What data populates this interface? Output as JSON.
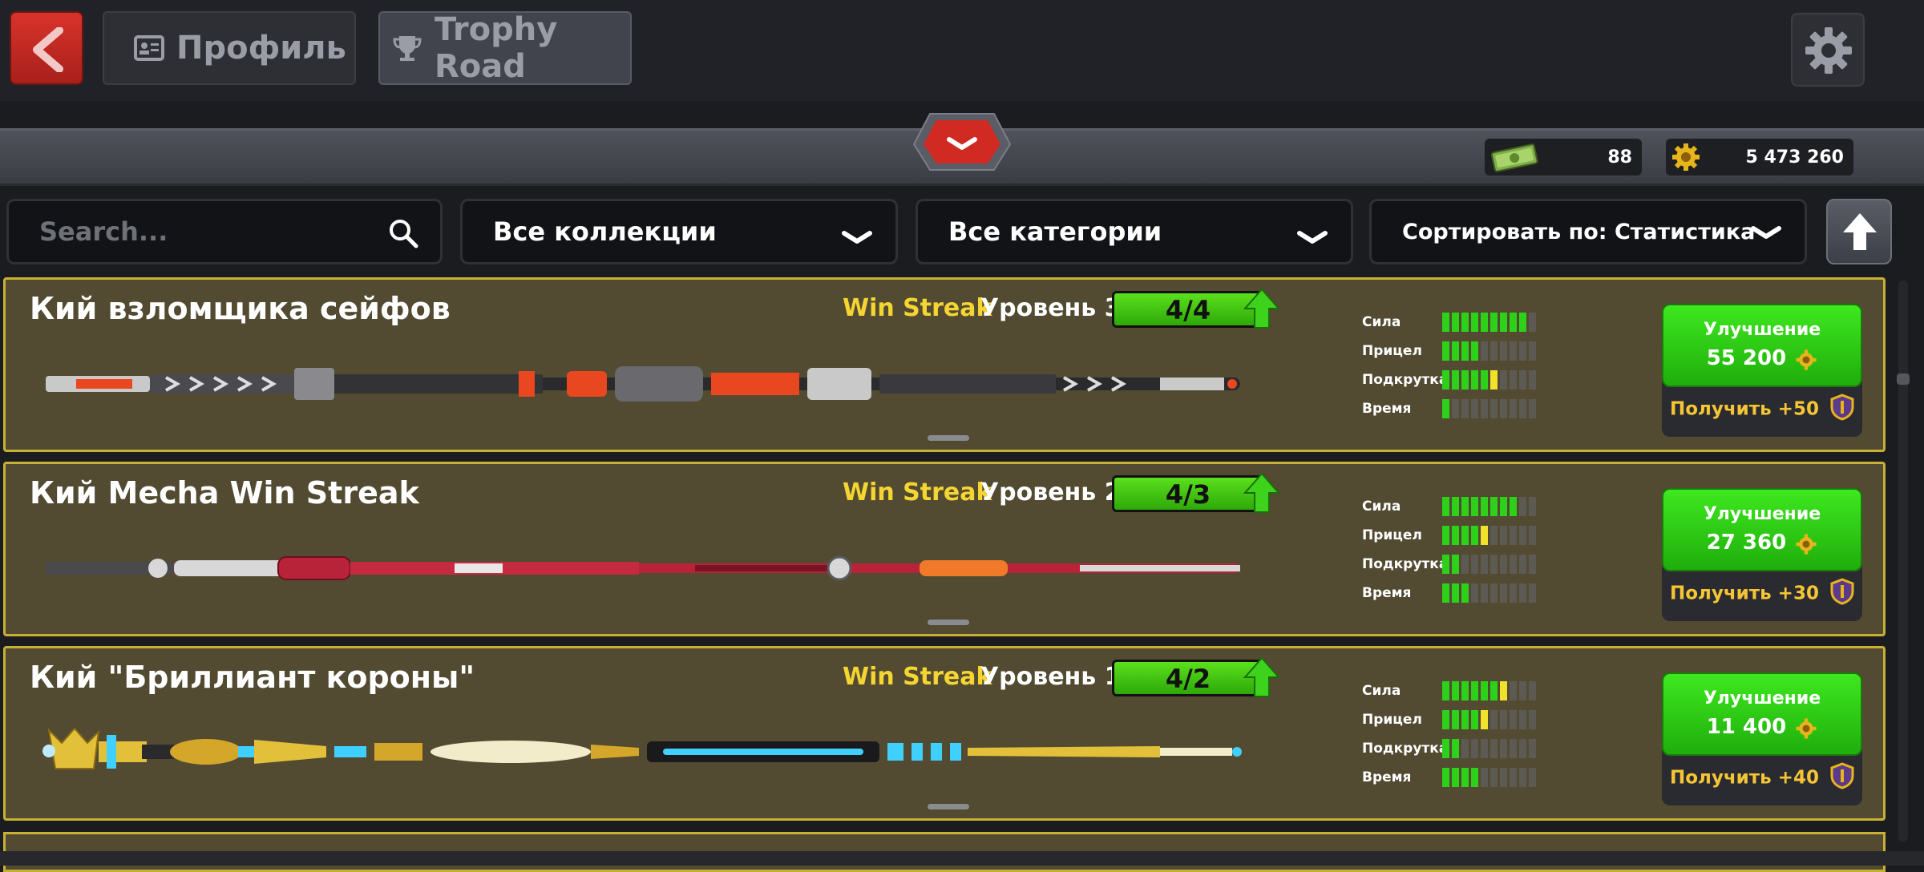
{
  "header": {
    "back_icon": "chevron-left-icon",
    "tabs": [
      {
        "label": "Профиль",
        "icon": "profile-card-icon"
      },
      {
        "label": "Trophy Road",
        "icon": "trophy-icon"
      }
    ],
    "settings_icon": "gear-icon"
  },
  "wallet": {
    "cash": {
      "value": "88",
      "icon": "cash-icon"
    },
    "coins": {
      "value": "5 473 260",
      "icon": "coin-icon"
    }
  },
  "filters": {
    "search_placeholder": "Search...",
    "collections": "Все коллекции",
    "categories": "Все категории",
    "sort": "Сортировать по: Статистика"
  },
  "cues": [
    {
      "name": "Кий взломщика сейфов",
      "win_streak": "Win Streak",
      "level": "Уровень 3",
      "progress_text": "4/4",
      "progress_fraction": 1.0,
      "stats": [
        {
          "label": "Сила",
          "filled": 9,
          "highlight": 0
        },
        {
          "label": "Прицел",
          "filled": 4,
          "highlight": 0
        },
        {
          "label": "Подкрутка",
          "filled": 5,
          "highlight": 1
        },
        {
          "label": "Время",
          "filled": 1,
          "highlight": 0
        }
      ],
      "upgrade_label": "Улучшение",
      "upgrade_price": "55 200",
      "get_label": "Получить +50",
      "colors": {
        "body": "#3a3a3e",
        "accent": "#e8471f",
        "trim": "#c9c9c9"
      }
    },
    {
      "name": "Кий Mecha Win Streak",
      "win_streak": "Win Streak",
      "level": "Уровень 2",
      "progress_text": "4/3",
      "progress_fraction": 1.0,
      "stats": [
        {
          "label": "Сила",
          "filled": 8,
          "highlight": 0
        },
        {
          "label": "Прицел",
          "filled": 4,
          "highlight": 1
        },
        {
          "label": "Подкрутка",
          "filled": 2,
          "highlight": 0
        },
        {
          "label": "Время",
          "filled": 3,
          "highlight": 0
        }
      ],
      "upgrade_label": "Улучшение",
      "upgrade_price": "27 360",
      "get_label": "Получить +30",
      "colors": {
        "body": "#b8233a",
        "accent": "#f07a2a",
        "trim": "#d8d8d8"
      }
    },
    {
      "name": "Кий \"Бриллиант короны\"",
      "win_streak": "Win Streak",
      "level": "Уровень 1",
      "progress_text": "4/2",
      "progress_fraction": 1.0,
      "stats": [
        {
          "label": "Сила",
          "filled": 6,
          "highlight": 1
        },
        {
          "label": "Прицел",
          "filled": 4,
          "highlight": 1
        },
        {
          "label": "Подкрутка",
          "filled": 2,
          "highlight": 0
        },
        {
          "label": "Время",
          "filled": 4,
          "highlight": 0
        }
      ],
      "upgrade_label": "Улучшение",
      "upgrade_price": "11 400",
      "get_label": "Получить +40",
      "colors": {
        "body": "#d4a62a",
        "accent": "#3fd0ff",
        "trim": "#f3eccb"
      }
    }
  ]
}
